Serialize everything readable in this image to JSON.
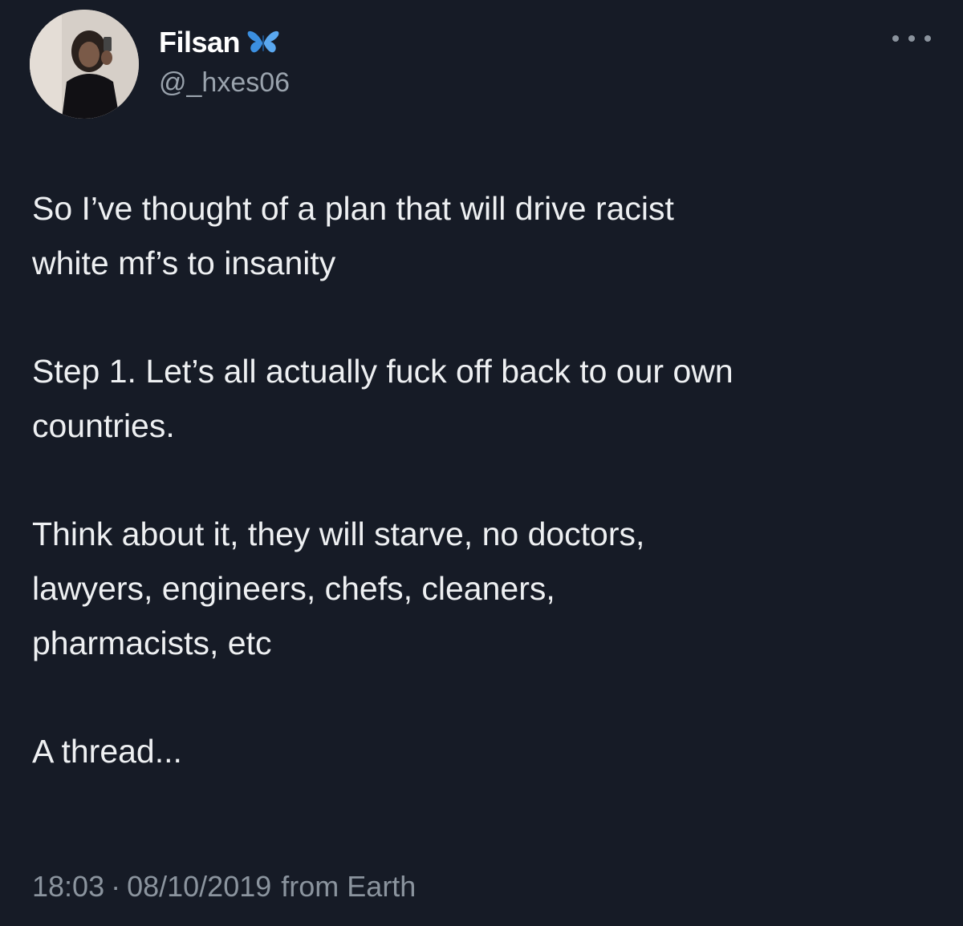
{
  "author": {
    "display_name": "Filsan",
    "handle": "@_hxes06",
    "badge_icon": "butterfly-icon",
    "more_icon": "more-options-icon"
  },
  "tweet": {
    "paragraphs": [
      "So I’ve thought of a plan that will drive racist\nwhite mf’s to insanity",
      "Step 1. Let’s all actually fuck off back to our own\ncountries.",
      "Think about it, they will starve, no doctors,\nlawyers, engineers, chefs, cleaners,\npharmacists, etc",
      "A thread..."
    ],
    "time": "18:03",
    "separator": "·",
    "date": "08/10/2019",
    "source": "from Earth"
  },
  "colors": {
    "background": "#161b26",
    "text": "#eef0f2",
    "muted": "#8b949e",
    "butterfly": "#3b8fe0"
  }
}
